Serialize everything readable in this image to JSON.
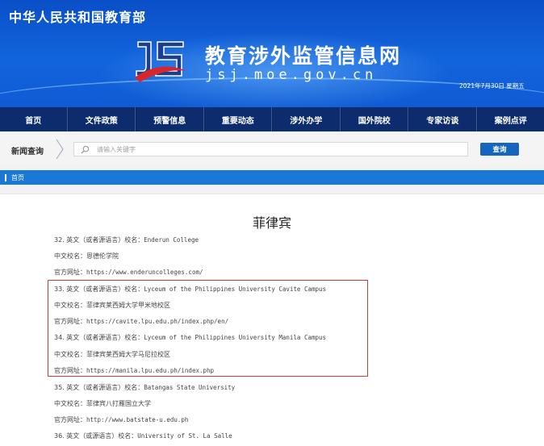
{
  "header": {
    "ministry": "中华人民共和国教育部",
    "site_title": "教育涉外监管信息网",
    "site_url": "jsj.moe.gov.cn",
    "date": "2021年7月30日 星期五"
  },
  "nav": [
    "首页",
    "文件政策",
    "预警信息",
    "重要动态",
    "涉外办学",
    "国外院校",
    "专家访谈",
    "案例点评"
  ],
  "search": {
    "title": "新闻查询",
    "placeholder": "请输入关键字",
    "button": "查询"
  },
  "breadcrumb": "首页",
  "article": {
    "title": "菲律宾",
    "lines": [
      {
        "label": "32. 英文（或者源语言）校名：",
        "value": "Enderun College"
      },
      {
        "label": "中文校名：",
        "value": "恩德伦学院"
      },
      {
        "label": "官方网址：",
        "value": "https://www.enderuncolleges.com/"
      },
      {
        "label": "33. 英文（或者源语言）校名：",
        "value": "Lyceum of the Philippines University Cavite Campus"
      },
      {
        "label": "中文校名：",
        "value": "菲律宾莱西姆大学甲米地校区"
      },
      {
        "label": "官方网址：",
        "value": "https://cavite.lpu.edu.ph/index.php/en/"
      },
      {
        "label": "34. 英文（或者源语言）校名：",
        "value": "Lyceum of the Philippines University Manila Campus"
      },
      {
        "label": "中文校名：",
        "value": "菲律宾莱西姆大学马尼拉校区"
      },
      {
        "label": "官方网址：",
        "value": "https://manila.lpu.edu.ph/index.php"
      },
      {
        "label": "35. 英文（或者源语言）校名：",
        "value": "Batangas State University"
      },
      {
        "label": "中文校名：",
        "value": "菲律宾八打雁国立大学"
      },
      {
        "label": "官方网址：",
        "value": "http://www.batstate-u.edu.ph"
      },
      {
        "label": "36. 英文（或源语言）校名：",
        "value": "University of St. La Salle"
      }
    ]
  },
  "colors": {
    "banner": "#0f5bd4",
    "nav": "#0c2c6e",
    "breadcrumb": "#1a79d6",
    "highlight_border": "#d13a32"
  }
}
